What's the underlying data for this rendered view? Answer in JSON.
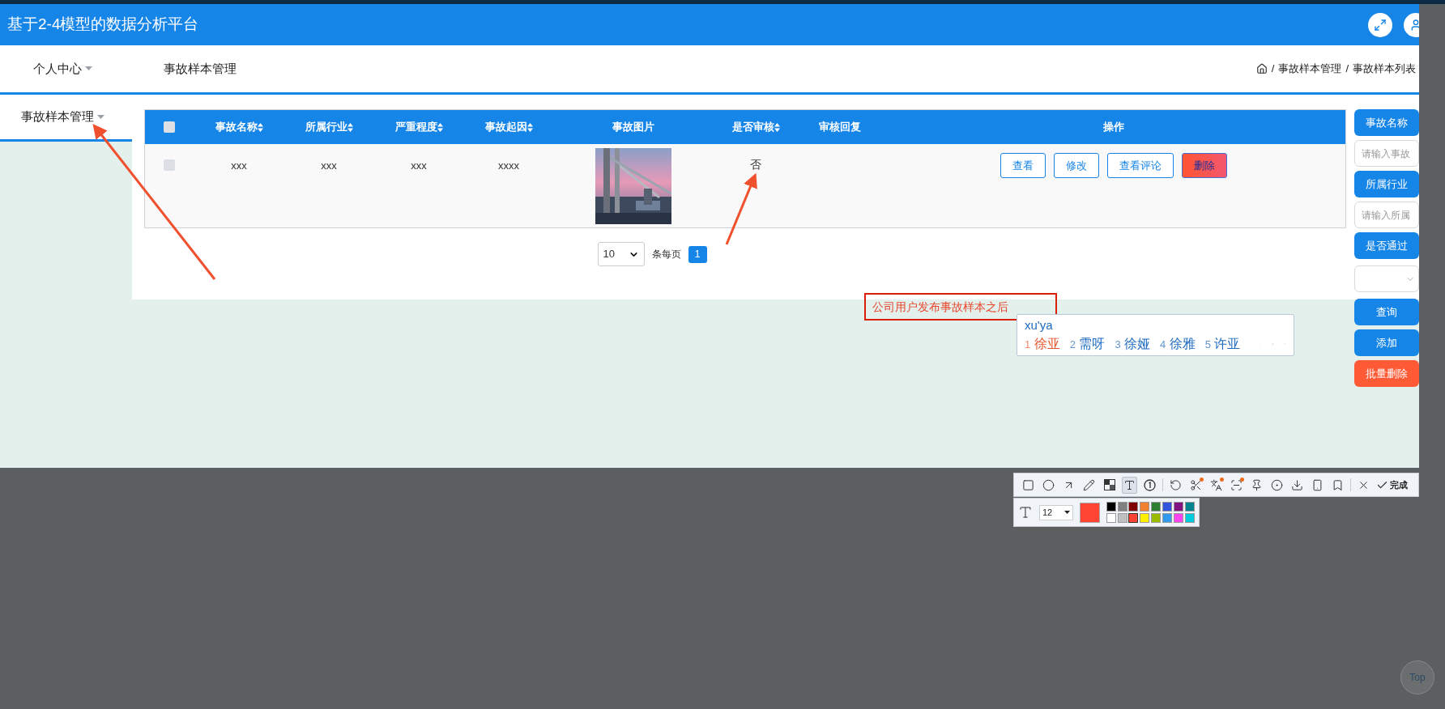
{
  "header": {
    "title": "基于2-4模型的数据分析平台"
  },
  "nav": {
    "items": [
      {
        "label": "个人中心",
        "dropdown": true
      },
      {
        "label": "事故样本管理",
        "dropdown": false
      }
    ]
  },
  "breadcrumb": [
    {
      "separator": "/",
      "label": "事故样本管理"
    },
    {
      "separator": "/",
      "label": "事故样本列表"
    }
  ],
  "sidebar": {
    "items": [
      {
        "label": "事故样本管理",
        "dropdown": true,
        "selected": true
      }
    ]
  },
  "table": {
    "header_checked": false,
    "columns": [
      {
        "label": "事故名称",
        "sortable": true
      },
      {
        "label": "所属行业",
        "sortable": true
      },
      {
        "label": "严重程度",
        "sortable": true
      },
      {
        "label": "事故起因",
        "sortable": true
      },
      {
        "label": "事故图片",
        "sortable": false
      },
      {
        "label": "是否审核",
        "sortable": true
      },
      {
        "label": "审核回复",
        "sortable": false
      },
      {
        "label": "操作",
        "sortable": false
      }
    ],
    "rows": [
      {
        "checked": false,
        "name": "xxx",
        "industry": "xxx",
        "severity": "xxx",
        "cause": "xxxx",
        "reviewed": "否",
        "actions": [
          {
            "label": "查看",
            "kind": "outline"
          },
          {
            "label": "修改",
            "kind": "outline"
          },
          {
            "label": "查看评论",
            "kind": "outline"
          },
          {
            "label": "删除",
            "kind": "danger"
          }
        ]
      }
    ]
  },
  "pagination": {
    "page_size": "10",
    "per_page_label": "条每页",
    "pages": [
      {
        "label": "1",
        "selected": true
      }
    ]
  },
  "search_panel": {
    "items": [
      {
        "kind": "label",
        "text": "事故名称"
      },
      {
        "kind": "input",
        "placeholder": "请输入事故"
      },
      {
        "kind": "label",
        "text": "所属行业"
      },
      {
        "kind": "input",
        "placeholder": "请输入所属"
      },
      {
        "kind": "label",
        "text": "是否通过"
      },
      {
        "kind": "select"
      },
      {
        "kind": "button",
        "text": "查询"
      },
      {
        "kind": "button",
        "text": "添加"
      },
      {
        "kind": "danger",
        "text": "批量删除"
      }
    ]
  },
  "annotation": {
    "text": "公司用户发布事故样本之后"
  },
  "ime": {
    "input": "xu'ya",
    "candidates": [
      {
        "index": "1",
        "text": "徐亚",
        "selected": true
      },
      {
        "index": "2",
        "text": "需呀",
        "selected": false
      },
      {
        "index": "3",
        "text": "徐娅",
        "selected": false
      },
      {
        "index": "4",
        "text": "徐雅",
        "selected": false
      },
      {
        "index": "5",
        "text": "许亚",
        "selected": false
      }
    ]
  },
  "capture_toolbar": {
    "tools": [
      {
        "kind": "rect",
        "selected": false,
        "badge": false
      },
      {
        "kind": "ellipse",
        "selected": false,
        "badge": false
      },
      {
        "kind": "arrow",
        "selected": false,
        "badge": false
      },
      {
        "kind": "pencil",
        "selected": false,
        "badge": false
      },
      {
        "kind": "mosaic",
        "selected": false,
        "badge": false
      },
      {
        "kind": "text",
        "selected": true,
        "badge": false
      },
      {
        "kind": "number",
        "selected": false,
        "badge": false
      },
      {
        "kind": "separator"
      },
      {
        "kind": "undo",
        "selected": false,
        "badge": false
      },
      {
        "kind": "scissors",
        "selected": false,
        "badge": true
      },
      {
        "kind": "translate",
        "selected": false,
        "badge": true
      },
      {
        "kind": "scan",
        "selected": false,
        "badge": true
      },
      {
        "kind": "pin",
        "selected": false,
        "badge": false
      },
      {
        "kind": "record",
        "selected": false,
        "badge": false
      },
      {
        "kind": "download",
        "selected": false,
        "badge": false
      },
      {
        "kind": "phone",
        "selected": false,
        "badge": false
      },
      {
        "kind": "bookmark",
        "selected": false,
        "badge": false
      },
      {
        "kind": "separator"
      },
      {
        "kind": "close",
        "selected": false,
        "badge": false
      }
    ],
    "done_label": "完成",
    "font_size": "12",
    "palette": [
      {
        "color": "#000000",
        "selected": false
      },
      {
        "color": "#808080",
        "selected": false
      },
      {
        "color": "#800000",
        "selected": false
      },
      {
        "color": "#f08030",
        "selected": false
      },
      {
        "color": "#2e7d32",
        "selected": false
      },
      {
        "color": "#3355dd",
        "selected": false
      },
      {
        "color": "#801480",
        "selected": false
      },
      {
        "color": "#00838f",
        "selected": false
      },
      {
        "color": "#ffffff",
        "selected": false
      },
      {
        "color": "#c0c0c0",
        "selected": false
      },
      {
        "color": "#ff4433",
        "selected": true
      },
      {
        "color": "#ffee00",
        "selected": false
      },
      {
        "color": "#99bb00",
        "selected": false
      },
      {
        "color": "#3399ee",
        "selected": false
      },
      {
        "color": "#ff44ee",
        "selected": false
      },
      {
        "color": "#00ccdd",
        "selected": false
      }
    ]
  },
  "top_button": {
    "label": "Top"
  }
}
